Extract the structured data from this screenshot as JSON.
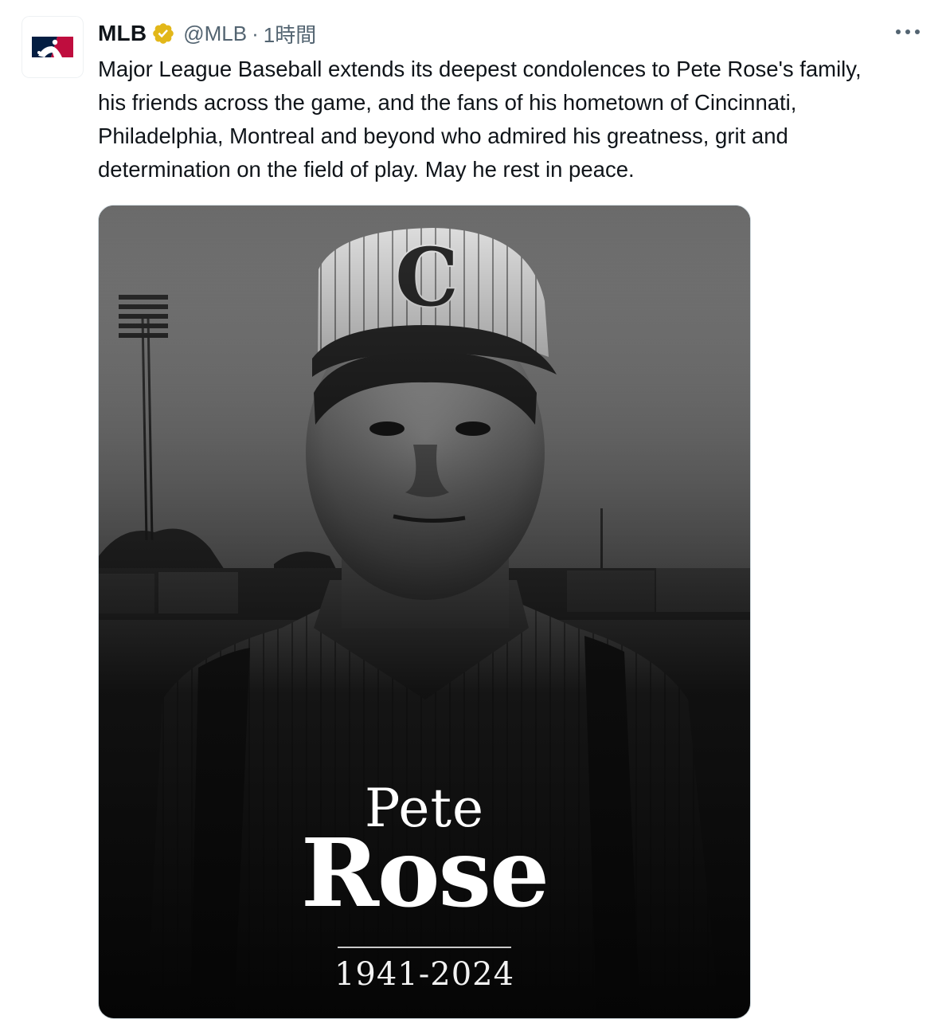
{
  "tweet": {
    "display_name": "MLB",
    "handle": "@MLB",
    "separator": "·",
    "timestamp": "1時間",
    "more_icon": "more-horizontal-icon",
    "verified_icon": "verified-badge-icon",
    "text": "Major League Baseball extends its deepest condolences to Pete Rose's family,\nhis friends across the game, and the fans of his hometown of Cincinnati,\nPhiladelphia, Montreal and beyond who admired his greatness, grit and\ndetermination on the field of play. May he rest in peace.",
    "media": {
      "first_name": "Pete",
      "last_name": "Rose",
      "years": "1941-2024",
      "cap_letter": "C"
    }
  },
  "colors": {
    "verified_gold": "#e2b719",
    "secondary_text": "#536471",
    "primary_text": "#0f1419",
    "mlb_blue": "#041e42",
    "mlb_red": "#bf0d3e"
  }
}
